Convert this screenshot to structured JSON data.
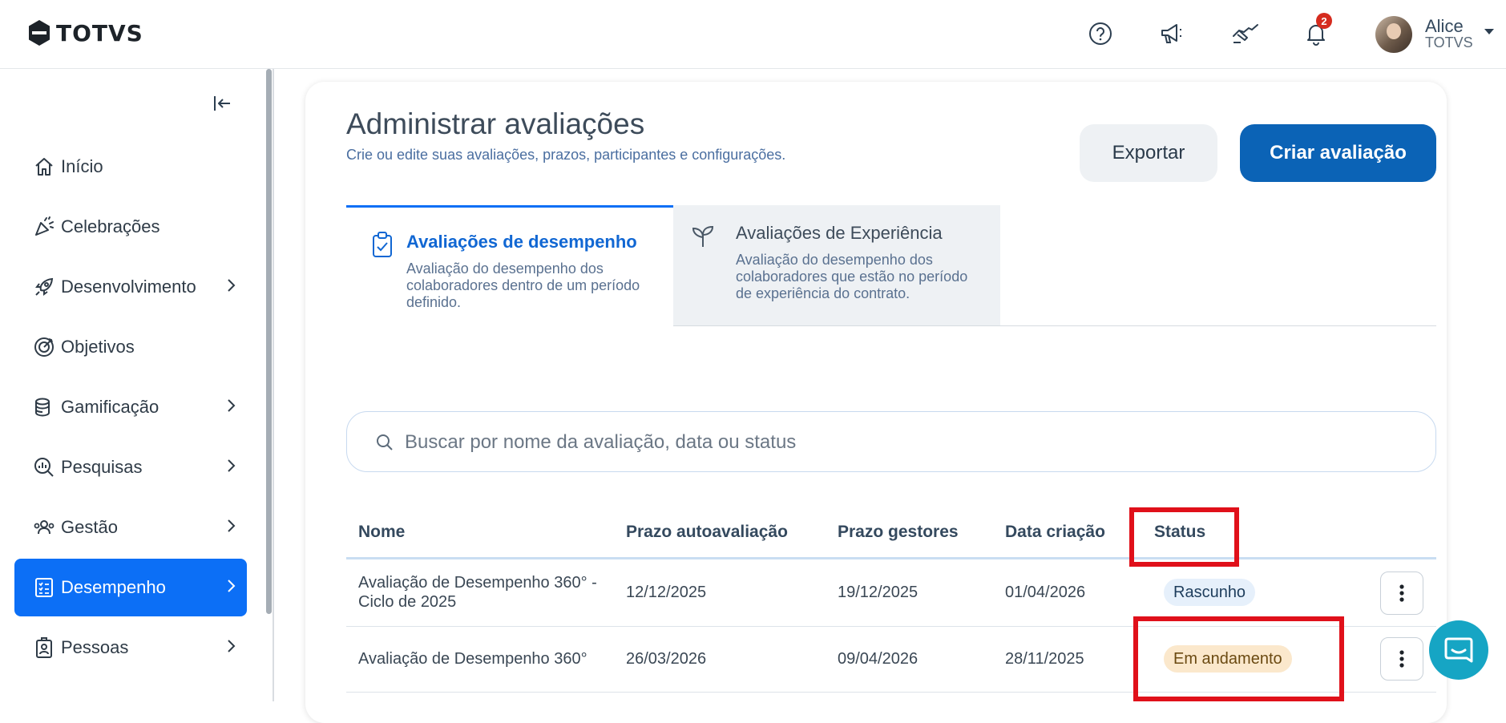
{
  "brand": {
    "logo_text": "TOTVS"
  },
  "header": {
    "notification_count": "2",
    "user": {
      "name": "Alice",
      "company": "TOTVS"
    }
  },
  "sidebar": {
    "items": [
      {
        "label": "Início",
        "icon": "home-icon",
        "has_submenu": false,
        "active": false
      },
      {
        "label": "Celebrações",
        "icon": "party-popper-icon",
        "has_submenu": false,
        "active": false
      },
      {
        "label": "Desenvolvimento",
        "icon": "rocket-icon",
        "has_submenu": true,
        "active": false
      },
      {
        "label": "Objetivos",
        "icon": "target-icon",
        "has_submenu": false,
        "active": false
      },
      {
        "label": "Gamificação",
        "icon": "coins-icon",
        "has_submenu": true,
        "active": false
      },
      {
        "label": "Pesquisas",
        "icon": "chart-search-icon",
        "has_submenu": true,
        "active": false
      },
      {
        "label": "Gestão",
        "icon": "users-icon",
        "has_submenu": true,
        "active": false
      },
      {
        "label": "Desempenho",
        "icon": "checklist-icon",
        "has_submenu": true,
        "active": true
      },
      {
        "label": "Pessoas",
        "icon": "badge-icon",
        "has_submenu": true,
        "active": false
      }
    ]
  },
  "page": {
    "title": "Administrar avaliações",
    "subtitle": "Crie ou edite suas avaliações, prazos, participantes e configurações.",
    "export_label": "Exportar",
    "create_label": "Criar avaliação"
  },
  "tabs": [
    {
      "title": "Avaliações de desempenho",
      "description": "Avaliação do desempenho dos colaboradores dentro de um período definido.",
      "active": true
    },
    {
      "title": "Avaliações de Experiência",
      "description": "Avaliação do desempenho dos colaboradores que estão no período de experiência do contrato.",
      "active": false
    }
  ],
  "search": {
    "placeholder": "Buscar por nome da avaliação, data ou status",
    "value": ""
  },
  "table": {
    "columns": [
      "Nome",
      "Prazo autoavaliação",
      "Prazo gestores",
      "Data criação",
      "Status"
    ],
    "rows": [
      {
        "name": "Avaliação de Desempenho 360° - Ciclo de 2025",
        "self_deadline": "12/12/2025",
        "manager_deadline": "19/12/2025",
        "created": "01/04/2026",
        "status": "Rascunho",
        "status_color": "#e6f0fb"
      },
      {
        "name": "Avaliação de Desempenho 360°",
        "self_deadline": "26/03/2026",
        "manager_deadline": "09/04/2026",
        "created": "28/11/2025",
        "status": "Em andamento",
        "status_color": "#fbe8cc"
      }
    ]
  },
  "colors": {
    "accent": "#0c6ff6",
    "primary_button": "#0b63b6",
    "highlight": "#e0101a",
    "chat_fab": "#16a5c4"
  }
}
